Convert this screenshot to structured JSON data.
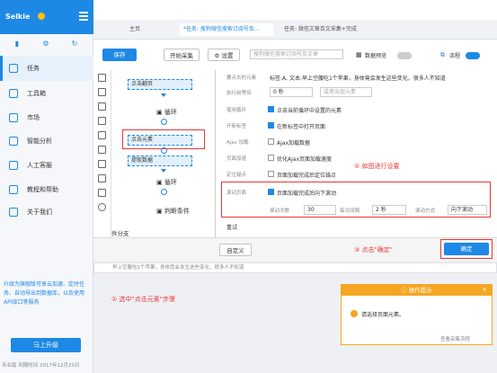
{
  "app": {
    "name": "Selkie"
  },
  "sidebar": {
    "items": [
      {
        "label": "任务"
      },
      {
        "label": "工具箱"
      },
      {
        "label": "市场"
      },
      {
        "label": "智能分析"
      },
      {
        "label": "人工客服"
      },
      {
        "label": "教程和帮助"
      },
      {
        "label": "关于我们"
      }
    ],
    "promo": "升级为旗舰版可享云加速、定时任务、自动导出到数据库，以及使用API接口等服务",
    "upgrade": "马上升级",
    "footer": "专业版   到期时间 2017年12月20日"
  },
  "tabs": [
    {
      "label": "主页"
    },
    {
      "label": "*任务: 搜狗微信搜索订阅号及..."
    },
    {
      "label": "任务: 微信文章百文采集+完成"
    }
  ],
  "toolbar": {
    "save": "保存",
    "start": "开始采集",
    "settings": "设置",
    "search_placeholder": "搜狗微信搜索订阅号及文章",
    "data_preview": "数据预览",
    "flow": "流程"
  },
  "flow": {
    "steps": [
      {
        "label": "点击翻页"
      },
      {
        "label": "循环"
      },
      {
        "label": "点击元素"
      },
      {
        "label": "提取数据"
      },
      {
        "label": "循环"
      },
      {
        "label": "判断条件"
      }
    ],
    "branch": "件分支"
  },
  "settings": {
    "selected_element_label": "要点击的元素",
    "selected_element_value": "标签:A, 文本:早上空腹吃1个苹果，身体竟会发生这些变化，很多人不知道",
    "wait_label": "执行前等待",
    "wait_value": "0 秒",
    "wait_appear_placeholder": "或者出现元素",
    "use_loop_label": "使用循环",
    "use_loop_text": "点击当前循环中设置的元素",
    "new_tab_label": "开新标签",
    "new_tab_text": "在新标签中打开页面",
    "ajax_label": "Ajax 加载",
    "ajax_text": "Ajax加载数据",
    "speed_label": "页面加速",
    "speed_text": "优化Ajax页面加载速度",
    "anchor_label": "定位锚点",
    "anchor_text": "页面加载完成后定位锚点",
    "scroll_label": "滚动页面",
    "scroll_text": "页面加载完成后向下滚动",
    "scroll_times_label": "滚动次数",
    "scroll_times": "30",
    "interval_label": "每次间隔",
    "interval": "2 秒",
    "scroll_mode_label": "滚动方式",
    "scroll_mode": "向下滚动",
    "retry": "重试"
  },
  "annotations": {
    "a1": "① 选中\"点击元素\"步骤",
    "a2": "② 如图进行设置",
    "a3": "③ 点击\"确定\""
  },
  "bottom": {
    "custom": "自定义",
    "ok": "确定"
  },
  "browser": {
    "url": "早上空腹吃1个苹果，身体竟会发生这些变化，很多人不知道"
  },
  "tip": {
    "title": "操作提示",
    "text": "请选择页面元素。",
    "link": "查看采集流程"
  },
  "colors": {
    "accent": "#1e88e5",
    "annotation": "#e53935",
    "tip": "#f5a623"
  }
}
